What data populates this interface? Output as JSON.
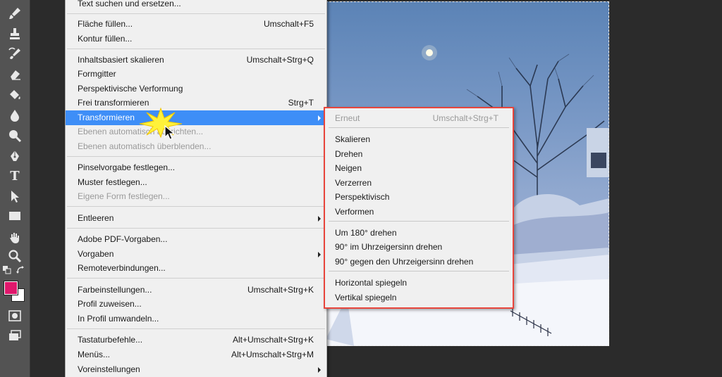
{
  "tools": [
    {
      "icon": "brush-icon"
    },
    {
      "icon": "stamp-icon"
    },
    {
      "icon": "history-brush-icon"
    },
    {
      "icon": "eraser-icon"
    },
    {
      "icon": "paint-bucket-icon"
    },
    {
      "icon": "blur-drop-icon"
    },
    {
      "icon": "dodge-icon"
    },
    {
      "icon": "pen-icon"
    },
    {
      "icon": "type-icon",
      "glyph": "T"
    },
    {
      "icon": "path-selection-icon"
    },
    {
      "icon": "rectangle-icon"
    },
    {
      "icon": "hand-icon"
    },
    {
      "icon": "zoom-icon"
    }
  ],
  "colors": {
    "foreground": "#e0186c",
    "background": "#ffffff",
    "menu_highlight": "#3e8ef7",
    "submenu_outline": "#e8453c"
  },
  "edit_menu": {
    "items": [
      {
        "label": "Text suchen und ersetzen...",
        "shortcut": "",
        "disabled": false,
        "submenu": false,
        "active": false
      },
      {
        "label": "Fläche füllen...",
        "shortcut": "Umschalt+F5",
        "disabled": false,
        "submenu": false,
        "active": false
      },
      {
        "label": "Kontur füllen...",
        "shortcut": "",
        "disabled": false,
        "submenu": false,
        "active": false
      },
      {
        "label": "Inhaltsbasiert skalieren",
        "shortcut": "Umschalt+Strg+Q",
        "disabled": false,
        "submenu": false,
        "active": false
      },
      {
        "label": "Formgitter",
        "shortcut": "",
        "disabled": false,
        "submenu": false,
        "active": false
      },
      {
        "label": "Perspektivische Verformung",
        "shortcut": "",
        "disabled": false,
        "submenu": false,
        "active": false
      },
      {
        "label": "Frei transformieren",
        "shortcut": "Strg+T",
        "disabled": false,
        "submenu": false,
        "active": false
      },
      {
        "label": "Transformieren",
        "shortcut": "",
        "disabled": false,
        "submenu": true,
        "active": true
      },
      {
        "label": "Ebenen automatisch ausrichten...",
        "shortcut": "",
        "disabled": true,
        "submenu": false,
        "active": false
      },
      {
        "label": "Ebenen automatisch überblenden...",
        "shortcut": "",
        "disabled": true,
        "submenu": false,
        "active": false
      },
      {
        "label": "Pinselvorgabe festlegen...",
        "shortcut": "",
        "disabled": false,
        "submenu": false,
        "active": false
      },
      {
        "label": "Muster festlegen...",
        "shortcut": "",
        "disabled": false,
        "submenu": false,
        "active": false
      },
      {
        "label": "Eigene Form festlegen...",
        "shortcut": "",
        "disabled": true,
        "submenu": false,
        "active": false
      },
      {
        "label": "Entleeren",
        "shortcut": "",
        "disabled": false,
        "submenu": true,
        "active": false
      },
      {
        "label": "Adobe PDF-Vorgaben...",
        "shortcut": "",
        "disabled": false,
        "submenu": false,
        "active": false
      },
      {
        "label": "Vorgaben",
        "shortcut": "",
        "disabled": false,
        "submenu": true,
        "active": false
      },
      {
        "label": "Remoteverbindungen...",
        "shortcut": "",
        "disabled": false,
        "submenu": false,
        "active": false
      },
      {
        "label": "Farbeinstellungen...",
        "shortcut": "Umschalt+Strg+K",
        "disabled": false,
        "submenu": false,
        "active": false
      },
      {
        "label": "Profil zuweisen...",
        "shortcut": "",
        "disabled": false,
        "submenu": false,
        "active": false
      },
      {
        "label": "In Profil umwandeln...",
        "shortcut": "",
        "disabled": false,
        "submenu": false,
        "active": false
      },
      {
        "label": "Tastaturbefehle...",
        "shortcut": "Alt+Umschalt+Strg+K",
        "disabled": false,
        "submenu": false,
        "active": false
      },
      {
        "label": "Menüs...",
        "shortcut": "Alt+Umschalt+Strg+M",
        "disabled": false,
        "submenu": false,
        "active": false
      },
      {
        "label": "Voreinstellungen",
        "shortcut": "",
        "disabled": false,
        "submenu": true,
        "active": false
      }
    ]
  },
  "transform_submenu": {
    "items": [
      {
        "label": "Erneut",
        "shortcut": "Umschalt+Strg+T",
        "disabled": true
      },
      {
        "label": "Skalieren",
        "shortcut": "",
        "disabled": false
      },
      {
        "label": "Drehen",
        "shortcut": "",
        "disabled": false
      },
      {
        "label": "Neigen",
        "shortcut": "",
        "disabled": false
      },
      {
        "label": "Verzerren",
        "shortcut": "",
        "disabled": false
      },
      {
        "label": "Perspektivisch",
        "shortcut": "",
        "disabled": false
      },
      {
        "label": "Verformen",
        "shortcut": "",
        "disabled": false
      },
      {
        "label": "Um 180° drehen",
        "shortcut": "",
        "disabled": false
      },
      {
        "label": "90° im Uhrzeigersinn drehen",
        "shortcut": "",
        "disabled": false
      },
      {
        "label": "90° gegen den Uhrzeigersinn drehen",
        "shortcut": "",
        "disabled": false
      },
      {
        "label": "Horizontal spiegeln",
        "shortcut": "",
        "disabled": false
      },
      {
        "label": "Vertikal spiegeln",
        "shortcut": "",
        "disabled": false
      }
    ]
  }
}
